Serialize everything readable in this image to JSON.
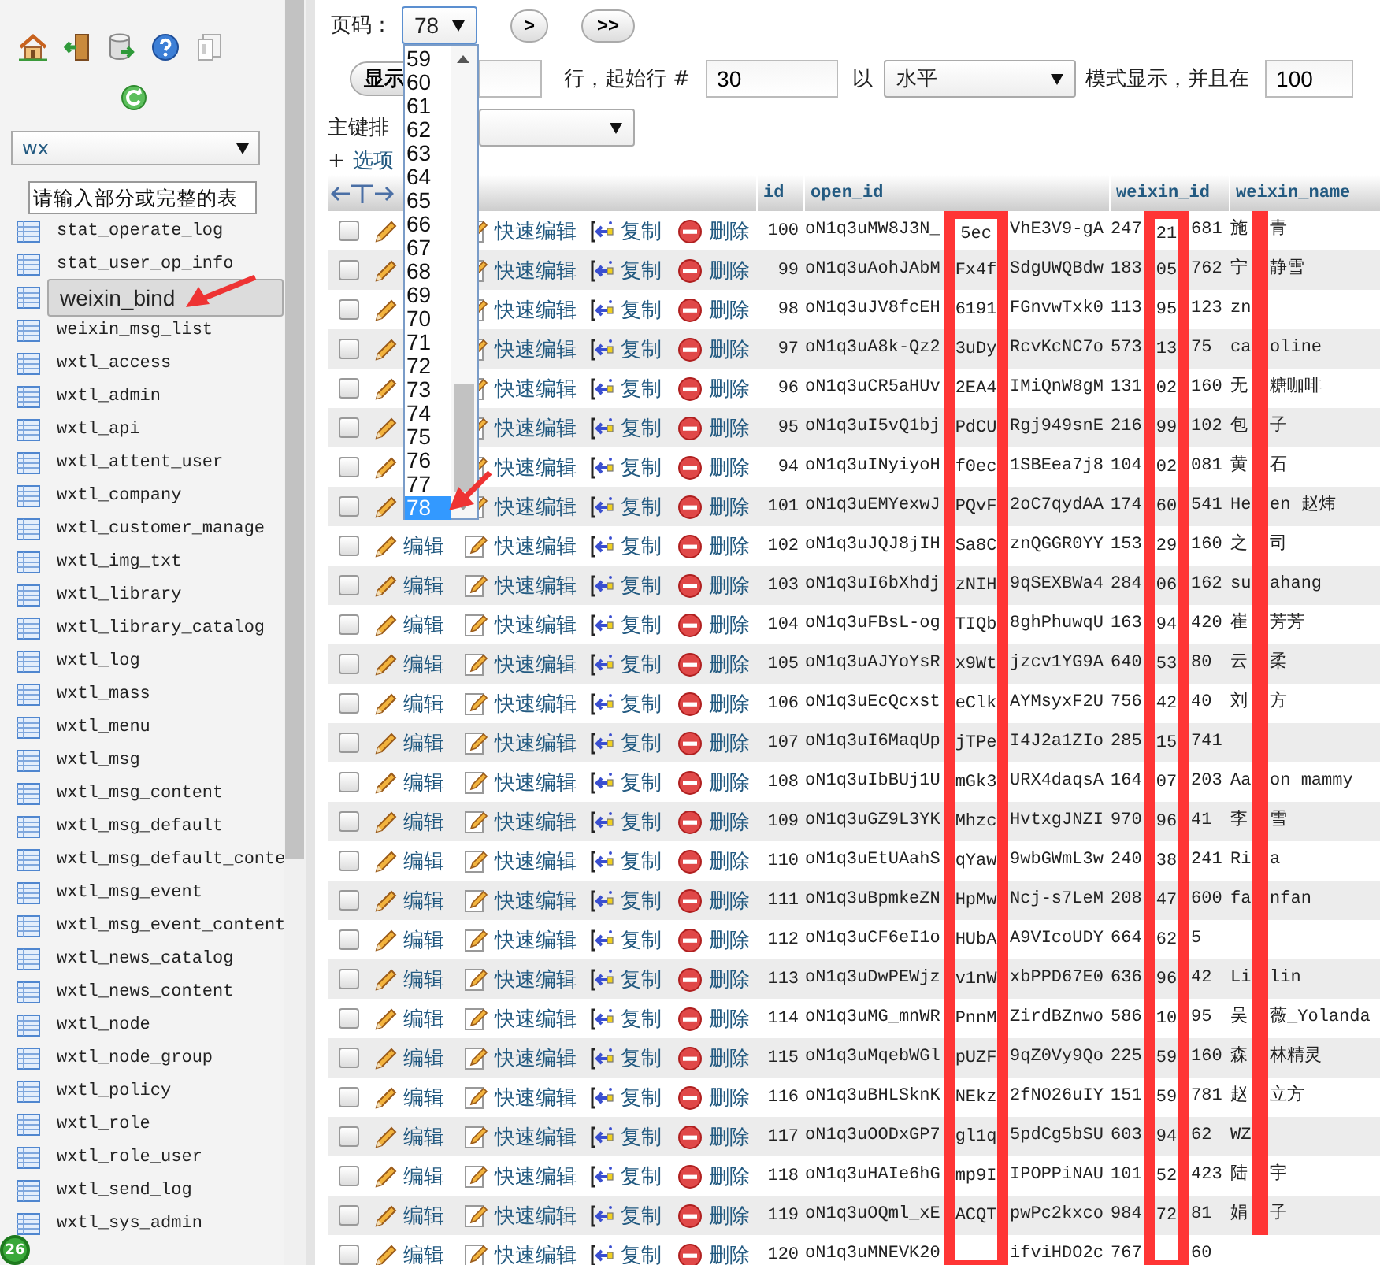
{
  "sidebar": {
    "database": "wx",
    "filter_placeholder": "请输入部分或完整的表",
    "badge": "26",
    "tables": [
      {
        "name": "stat_operate_log",
        "selected": false
      },
      {
        "name": "stat_user_op_info",
        "selected": false
      },
      {
        "name": "weixin_bind",
        "selected": true
      },
      {
        "name": "weixin_msg_list",
        "selected": false
      },
      {
        "name": "wxtl_access",
        "selected": false
      },
      {
        "name": "wxtl_admin",
        "selected": false
      },
      {
        "name": "wxtl_api",
        "selected": false
      },
      {
        "name": "wxtl_attent_user",
        "selected": false
      },
      {
        "name": "wxtl_company",
        "selected": false
      },
      {
        "name": "wxtl_customer_manage",
        "selected": false
      },
      {
        "name": "wxtl_img_txt",
        "selected": false
      },
      {
        "name": "wxtl_library",
        "selected": false
      },
      {
        "name": "wxtl_library_catalog",
        "selected": false
      },
      {
        "name": "wxtl_log",
        "selected": false
      },
      {
        "name": "wxtl_mass",
        "selected": false
      },
      {
        "name": "wxtl_menu",
        "selected": false
      },
      {
        "name": "wxtl_msg",
        "selected": false
      },
      {
        "name": "wxtl_msg_content",
        "selected": false
      },
      {
        "name": "wxtl_msg_default",
        "selected": false
      },
      {
        "name": "wxtl_msg_default_conte",
        "selected": false
      },
      {
        "name": "wxtl_msg_event",
        "selected": false
      },
      {
        "name": "wxtl_msg_event_content",
        "selected": false
      },
      {
        "name": "wxtl_news_catalog",
        "selected": false
      },
      {
        "name": "wxtl_news_content",
        "selected": false
      },
      {
        "name": "wxtl_node",
        "selected": false
      },
      {
        "name": "wxtl_node_group",
        "selected": false
      },
      {
        "name": "wxtl_policy",
        "selected": false
      },
      {
        "name": "wxtl_role",
        "selected": false
      },
      {
        "name": "wxtl_role_user",
        "selected": false
      },
      {
        "name": "wxtl_send_log",
        "selected": false
      },
      {
        "name": "wxtl_sys_admin",
        "selected": false
      }
    ]
  },
  "navigation": {
    "page_label": "页码：",
    "page_value": "78",
    "next_button": ">",
    "last_button": ">>",
    "page_options": [
      {
        "label": "59",
        "selected": false
      },
      {
        "label": "60",
        "selected": false
      },
      {
        "label": "61",
        "selected": false
      },
      {
        "label": "62",
        "selected": false
      },
      {
        "label": "63",
        "selected": false
      },
      {
        "label": "64",
        "selected": false
      },
      {
        "label": "65",
        "selected": false
      },
      {
        "label": "66",
        "selected": false
      },
      {
        "label": "67",
        "selected": false
      },
      {
        "label": "68",
        "selected": false
      },
      {
        "label": "69",
        "selected": false
      },
      {
        "label": "70",
        "selected": false
      },
      {
        "label": "71",
        "selected": false
      },
      {
        "label": "72",
        "selected": false
      },
      {
        "label": "73",
        "selected": false
      },
      {
        "label": "74",
        "selected": false
      },
      {
        "label": "75",
        "selected": false
      },
      {
        "label": "76",
        "selected": false
      },
      {
        "label": "77",
        "selected": false
      },
      {
        "label": "78",
        "selected": true
      }
    ]
  },
  "display": {
    "show_button": "显示",
    "rows_label": "行，起始行 #",
    "start_row": "30",
    "mode_prefix": "以",
    "mode_select": "水平",
    "mode_suffix": "模式显示，并且在",
    "repeat_value": "100"
  },
  "sort": {
    "label": "主键排"
  },
  "options": {
    "plus": "+",
    "label": "选项"
  },
  "table": {
    "columns": [
      "id",
      "open_id",
      "weixin_id",
      "weixin_name"
    ],
    "rows": [
      {
        "checked": false,
        "quick_edit": "快速编辑",
        "copy": "复制",
        "delete": "删除",
        "id": "100",
        "open_id": {
          "before": "oN1q3uMW8J3N_",
          "inside": "5ec",
          "after": "VhE3V9-gA"
        },
        "weixin_id": {
          "before": "247",
          "inside": "21",
          "after": "681"
        },
        "weixin_name": {
          "before": "施",
          "after": "青"
        }
      },
      {
        "checked": false,
        "quick_edit": "快速编辑",
        "copy": "复制",
        "delete": "删除",
        "id": "99",
        "open_id": {
          "before": "oN1q3uAohJAbM",
          "inside": "Fx4f",
          "after": "SdgUWQBdw"
        },
        "weixin_id": {
          "before": "183",
          "inside": "05",
          "after": "762"
        },
        "weixin_name": {
          "before": "宁",
          "after": "静雪"
        }
      },
      {
        "checked": false,
        "quick_edit": "快速编辑",
        "copy": "复制",
        "delete": "删除",
        "id": "98",
        "open_id": {
          "before": "oN1q3uJV8fcEH",
          "inside": "6191",
          "after": "FGnvwTxk0"
        },
        "weixin_id": {
          "before": "113",
          "inside": "95",
          "after": "123"
        },
        "weixin_name": {
          "before": "zn"
        }
      },
      {
        "checked": false,
        "quick_edit": "快速编辑",
        "copy": "复制",
        "delete": "删除",
        "id": "97",
        "open_id": {
          "before": "oN1q3uA8k-Qz2",
          "inside": "3uDy",
          "after": "RcvKcNC7o"
        },
        "weixin_id": {
          "before": "573",
          "inside": "13",
          "after": "75"
        },
        "weixin_name": {
          "before": "ca",
          "after": "oline"
        }
      },
      {
        "checked": false,
        "quick_edit": "快速编辑",
        "copy": "复制",
        "delete": "删除",
        "id": "96",
        "open_id": {
          "before": "oN1q3uCR5aHUv",
          "inside": "2EA4",
          "after": "IMiQnW8gM"
        },
        "weixin_id": {
          "before": "131",
          "inside": "02",
          "after": "160"
        },
        "weixin_name": {
          "before": "无",
          "after": "糖咖啡"
        }
      },
      {
        "checked": false,
        "quick_edit": "快速编辑",
        "copy": "复制",
        "delete": "删除",
        "id": "95",
        "open_id": {
          "before": "oN1q3uI5vQ1bj",
          "inside": "PdCU",
          "after": "Rgj949snE"
        },
        "weixin_id": {
          "before": "216",
          "inside": "99",
          "after": "102"
        },
        "weixin_name": {
          "before": "包",
          "after": "子"
        }
      },
      {
        "checked": false,
        "quick_edit": "快速编辑",
        "copy": "复制",
        "delete": "删除",
        "id": "94",
        "open_id": {
          "before": "oN1q3uINyiyoH",
          "inside": "f0ec",
          "after": "1SBEea7j8"
        },
        "weixin_id": {
          "before": "104",
          "inside": "02",
          "after": "081"
        },
        "weixin_name": {
          "before": "黄",
          "after": "石"
        }
      },
      {
        "checked": false,
        "quick_edit": "快速编辑",
        "copy": "复制",
        "delete": "删除",
        "id": "101",
        "open_id": {
          "before": "oN1q3uEMYexwJ",
          "inside": "PQvF",
          "after": "2oC7qydAA"
        },
        "weixin_id": {
          "before": "174",
          "inside": "60",
          "after": "541"
        },
        "weixin_name": {
          "before": "He",
          "after": "en 赵炜"
        }
      },
      {
        "checked": false,
        "edit": "编辑",
        "quick_edit": "快速编辑",
        "copy": "复制",
        "delete": "删除",
        "id": "102",
        "open_id": {
          "before": "oN1q3uJQJ8jIH",
          "inside": "Sa8C",
          "after": "znQGGR0YY"
        },
        "weixin_id": {
          "before": "153",
          "inside": "29",
          "after": "160"
        },
        "weixin_name": {
          "before": "之",
          "after": "司"
        }
      },
      {
        "checked": false,
        "edit": "编辑",
        "quick_edit": "快速编辑",
        "copy": "复制",
        "delete": "删除",
        "id": "103",
        "open_id": {
          "before": "oN1q3uI6bXhdj",
          "inside": "zNIH",
          "after": "9qSEXBWa4"
        },
        "weixin_id": {
          "before": "284",
          "inside": "06",
          "after": "162"
        },
        "weixin_name": {
          "before": "su",
          "after": "ahang"
        }
      },
      {
        "checked": false,
        "edit": "编辑",
        "quick_edit": "快速编辑",
        "copy": "复制",
        "delete": "删除",
        "id": "104",
        "open_id": {
          "before": "oN1q3uFBsL-og",
          "inside": "TIQb",
          "after": "8ghPhuwqU"
        },
        "weixin_id": {
          "before": "163",
          "inside": "94",
          "after": "420"
        },
        "weixin_name": {
          "before": "崔",
          "after": "芳芳"
        }
      },
      {
        "checked": false,
        "edit": "编辑",
        "quick_edit": "快速编辑",
        "copy": "复制",
        "delete": "删除",
        "id": "105",
        "open_id": {
          "before": "oN1q3uAJYoYsR",
          "inside": "x9Wt",
          "after": "jzcv1YG9A"
        },
        "weixin_id": {
          "before": "640",
          "inside": "53",
          "after": "80"
        },
        "weixin_name": {
          "before": "云",
          "after": "柔"
        }
      },
      {
        "checked": false,
        "edit": "编辑",
        "quick_edit": "快速编辑",
        "copy": "复制",
        "delete": "删除",
        "id": "106",
        "open_id": {
          "before": "oN1q3uEcQcxst",
          "inside": "eClk",
          "after": "AYMsyxF2U"
        },
        "weixin_id": {
          "before": "756",
          "inside": "42",
          "after": "40"
        },
        "weixin_name": {
          "before": "刘",
          "after": "方"
        }
      },
      {
        "checked": false,
        "edit": "编辑",
        "quick_edit": "快速编辑",
        "copy": "复制",
        "delete": "删除",
        "id": "107",
        "open_id": {
          "before": "oN1q3uI6MaqUp",
          "inside": "jTPe",
          "after": "I4J2a1ZIo"
        },
        "weixin_id": {
          "before": "285",
          "inside": "15",
          "after": "741"
        },
        "weixin_name": {}
      },
      {
        "checked": false,
        "edit": "编辑",
        "quick_edit": "快速编辑",
        "copy": "复制",
        "delete": "删除",
        "id": "108",
        "open_id": {
          "before": "oN1q3uIbBUj1U",
          "inside": "mGk3",
          "after": "URX4daqsA"
        },
        "weixin_id": {
          "before": "164",
          "inside": "07",
          "after": "203"
        },
        "weixin_name": {
          "before": "Aa",
          "after": "on mammy"
        }
      },
      {
        "checked": false,
        "edit": "编辑",
        "quick_edit": "快速编辑",
        "copy": "复制",
        "delete": "删除",
        "id": "109",
        "open_id": {
          "before": "oN1q3uGZ9L3YK",
          "inside": "Mhzc",
          "after": "HvtxgJNZI"
        },
        "weixin_id": {
          "before": "970",
          "inside": "96",
          "after": "41"
        },
        "weixin_name": {
          "before": "李",
          "after": "雪"
        }
      },
      {
        "checked": false,
        "edit": "编辑",
        "quick_edit": "快速编辑",
        "copy": "复制",
        "delete": "删除",
        "id": "110",
        "open_id": {
          "before": "oN1q3uEtUAahS",
          "inside": "qYaw",
          "after": "9wbGWmL3w"
        },
        "weixin_id": {
          "before": "240",
          "inside": "38",
          "after": "241"
        },
        "weixin_name": {
          "before": "Ri",
          "after": "a"
        }
      },
      {
        "checked": false,
        "edit": "编辑",
        "quick_edit": "快速编辑",
        "copy": "复制",
        "delete": "删除",
        "id": "111",
        "open_id": {
          "before": "oN1q3uBpmkeZN",
          "inside": "HpMw",
          "after": "Ncj-s7LeM"
        },
        "weixin_id": {
          "before": "208",
          "inside": "47",
          "after": "600"
        },
        "weixin_name": {
          "before": "fa",
          "after": "nfan"
        }
      },
      {
        "checked": false,
        "edit": "编辑",
        "quick_edit": "快速编辑",
        "copy": "复制",
        "delete": "删除",
        "id": "112",
        "open_id": {
          "before": "oN1q3uCF6eI1o",
          "inside": "HUbA",
          "after": "A9VIcoUDY"
        },
        "weixin_id": {
          "before": "664",
          "inside": "62",
          "after": "5"
        },
        "weixin_name": {}
      },
      {
        "checked": false,
        "edit": "编辑",
        "quick_edit": "快速编辑",
        "copy": "复制",
        "delete": "删除",
        "id": "113",
        "open_id": {
          "before": "oN1q3uDwPEWjz",
          "inside": "v1nW",
          "after": "xbPPD67E0"
        },
        "weixin_id": {
          "before": "636",
          "inside": "96",
          "after": "42"
        },
        "weixin_name": {
          "before": "Li",
          "after": "lin"
        }
      },
      {
        "checked": false,
        "edit": "编辑",
        "quick_edit": "快速编辑",
        "copy": "复制",
        "delete": "删除",
        "id": "114",
        "open_id": {
          "before": "oN1q3uMG_mnWR",
          "inside": "PnnM",
          "after": "ZirdBZnwo"
        },
        "weixin_id": {
          "before": "586",
          "inside": "10",
          "after": "95"
        },
        "weixin_name": {
          "before": "吴",
          "after": "薇_Yolanda"
        }
      },
      {
        "checked": false,
        "edit": "编辑",
        "quick_edit": "快速编辑",
        "copy": "复制",
        "delete": "删除",
        "id": "115",
        "open_id": {
          "before": "oN1q3uMqebWGl",
          "inside": "pUZF",
          "after": "9qZ0Vy9Qo"
        },
        "weixin_id": {
          "before": "225",
          "inside": "59",
          "after": "160"
        },
        "weixin_name": {
          "before": "森",
          "after": "林精灵"
        }
      },
      {
        "checked": false,
        "edit": "编辑",
        "quick_edit": "快速编辑",
        "copy": "复制",
        "delete": "删除",
        "id": "116",
        "open_id": {
          "before": "oN1q3uBHLSknK",
          "inside": "NEkz",
          "after": "2fNO26uIY"
        },
        "weixin_id": {
          "before": "151",
          "inside": "59",
          "after": "781"
        },
        "weixin_name": {
          "before": "赵",
          "after": "立方"
        }
      },
      {
        "checked": false,
        "edit": "编辑",
        "quick_edit": "快速编辑",
        "copy": "复制",
        "delete": "删除",
        "id": "117",
        "open_id": {
          "before": "oN1q3uOODxGP7",
          "inside": "gl1q",
          "after": "5pdCg5bSU"
        },
        "weixin_id": {
          "before": "603",
          "inside": "94",
          "after": "62"
        },
        "weixin_name": {
          "before": "WZ"
        }
      },
      {
        "checked": false,
        "edit": "编辑",
        "quick_edit": "快速编辑",
        "copy": "复制",
        "delete": "删除",
        "id": "118",
        "open_id": {
          "before": "oN1q3uHAIe6hG",
          "inside": "mp9I",
          "after": "IPOPPiNAU"
        },
        "weixin_id": {
          "before": "101",
          "inside": "52",
          "after": "423"
        },
        "weixin_name": {
          "before": "陆",
          "after": "宇"
        }
      },
      {
        "checked": false,
        "edit": "编辑",
        "quick_edit": "快速编辑",
        "copy": "复制",
        "delete": "删除",
        "id": "119",
        "open_id": {
          "before": "oN1q3uOQml_xE",
          "inside": "ACQT",
          "after": "pwPc2kxco"
        },
        "weixin_id": {
          "before": "984",
          "inside": "72",
          "after": "81"
        },
        "weixin_name": {
          "before": "娟",
          "after": "子"
        }
      },
      {
        "checked": false,
        "edit": "编辑",
        "quick_edit": "快速编辑",
        "copy": "复制",
        "delete": "删除",
        "id": "120",
        "open_id": {
          "before": "oN1q3uMNEVK20",
          "after": "ifviHDO2c"
        },
        "weixin_id": {
          "before": "767",
          "after": "60"
        },
        "weixin_name": {}
      }
    ]
  }
}
